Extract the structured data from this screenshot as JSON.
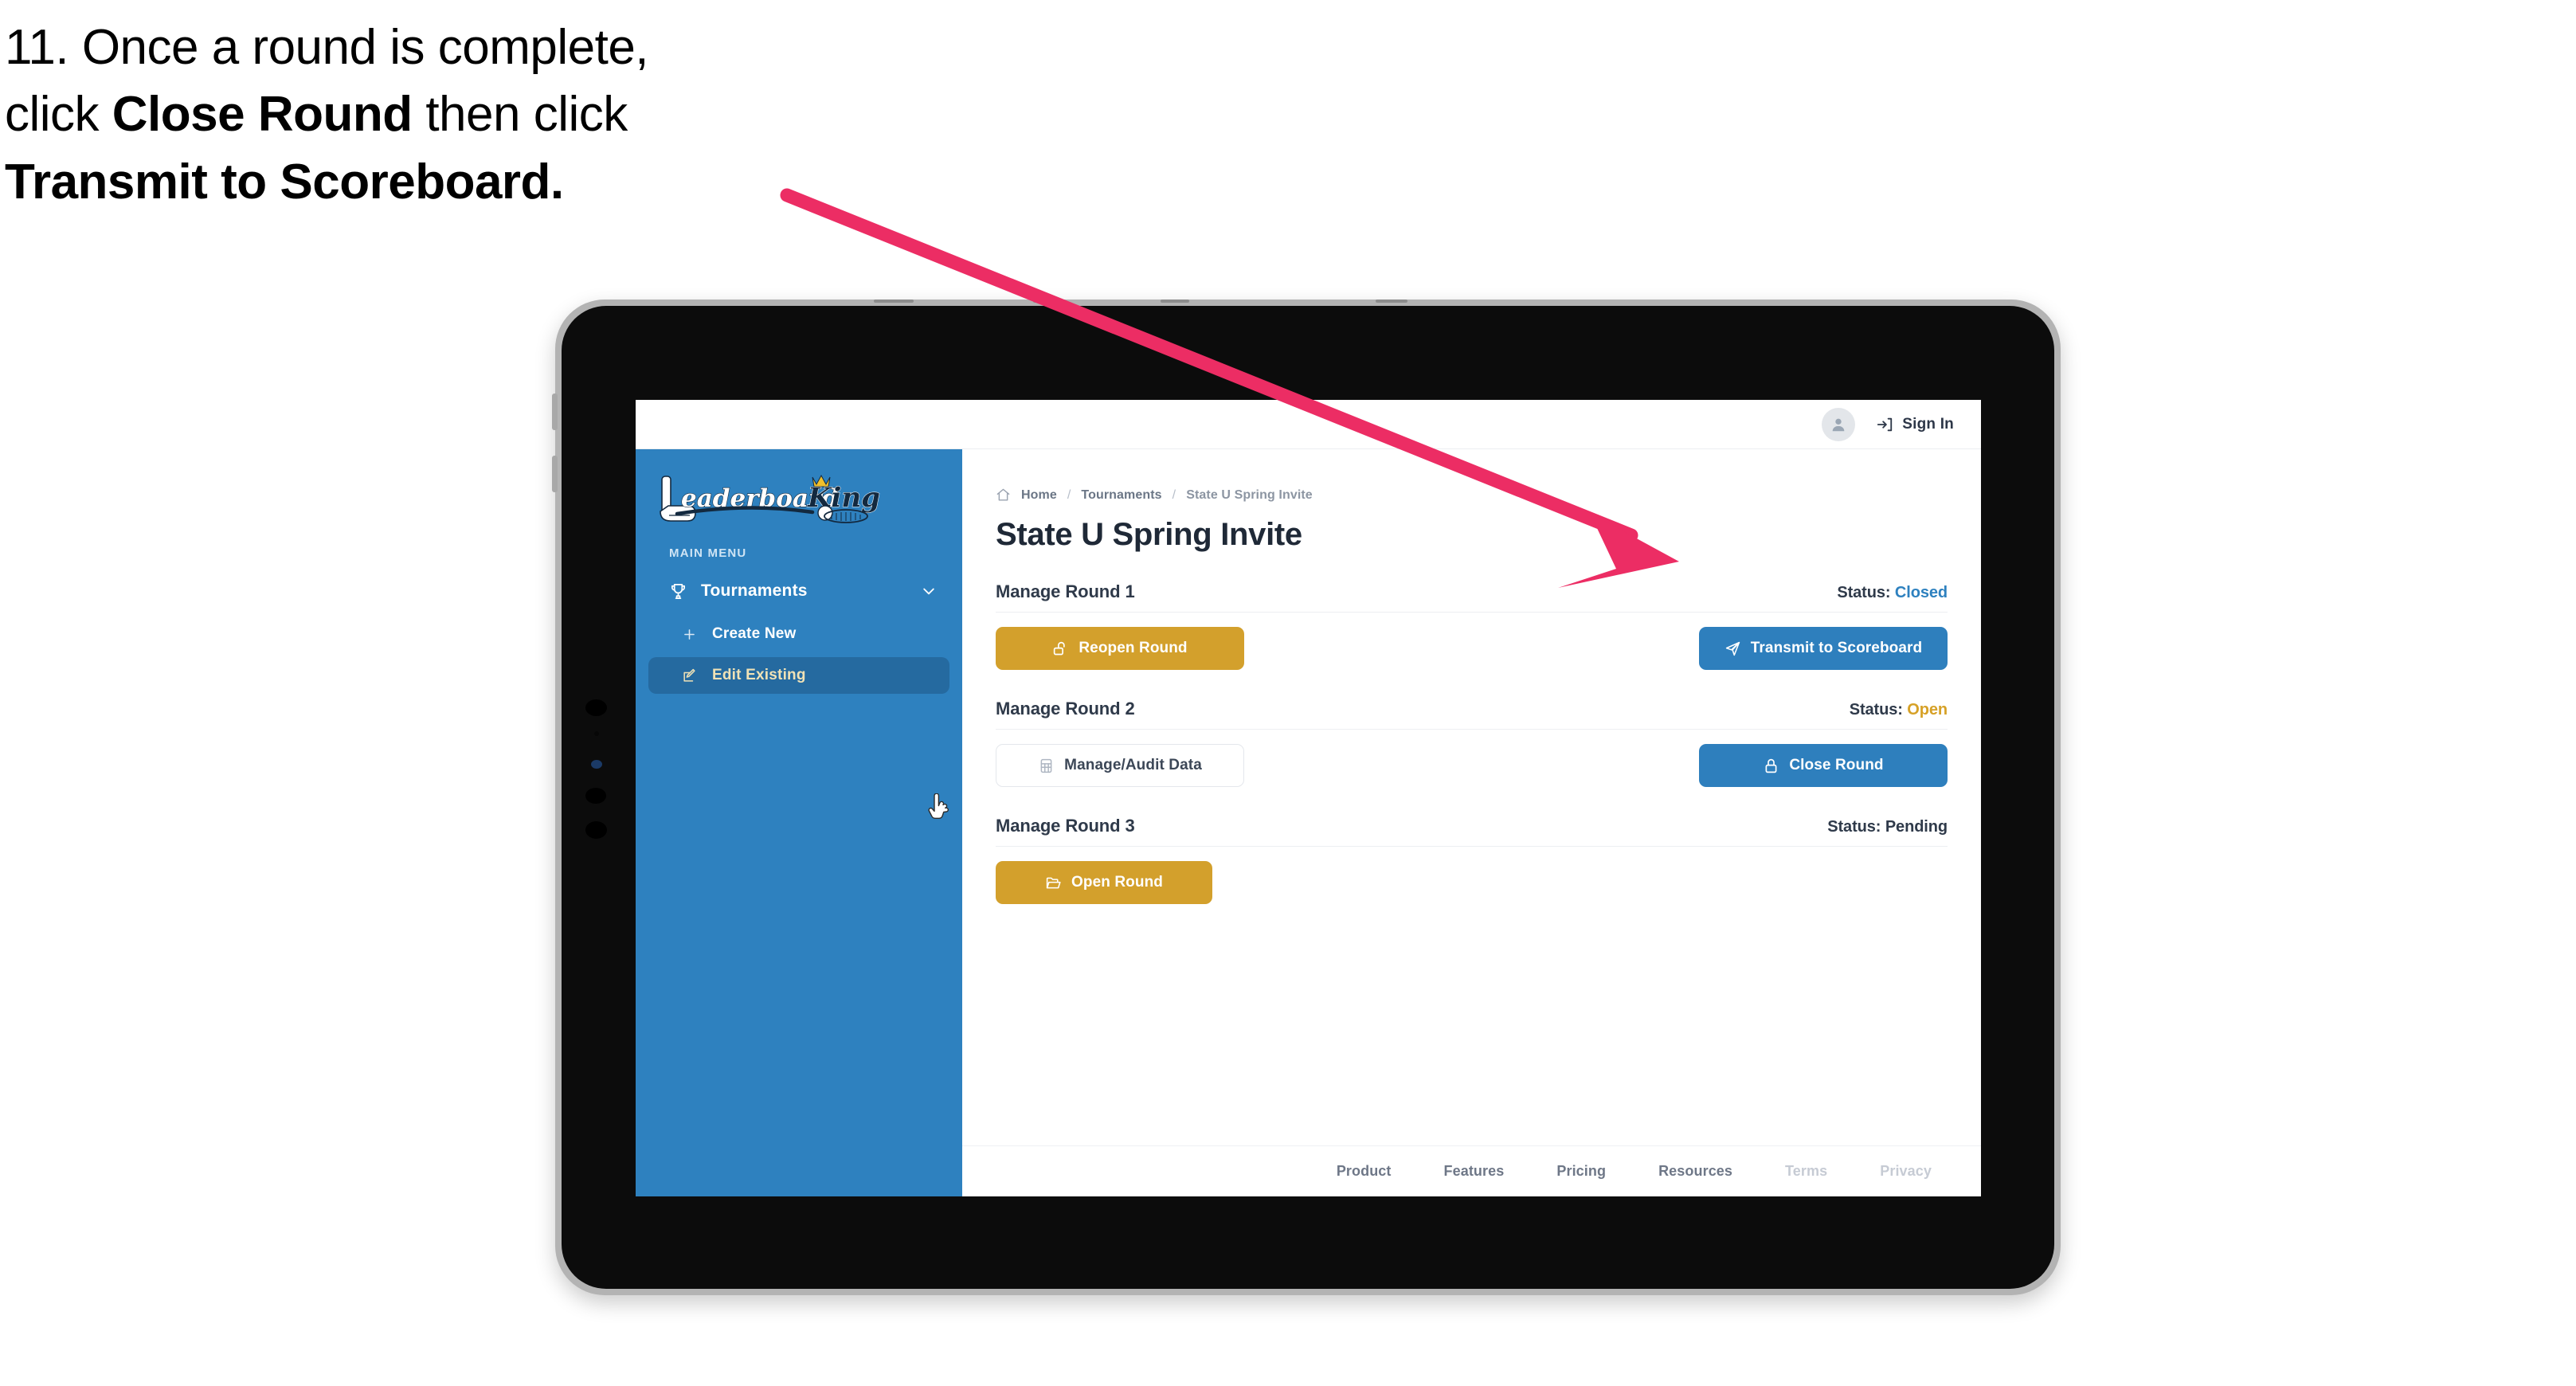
{
  "caption": {
    "line1": "11. Once a round is complete,",
    "line2_pre": "click ",
    "line2_bold": "Close Round",
    "line2_post": " then click",
    "line3_bold": "Transmit to Scoreboard.",
    "arrow_color": "#EC2D64"
  },
  "app": {
    "logo_primary": "Leaderboard",
    "logo_secondary": "King",
    "topbar": {
      "avatar_icon": "user-avatar-icon",
      "signin_icon": "sign-in-arrow-icon",
      "signin_label": "Sign In"
    },
    "sidebar": {
      "section_label": "MAIN MENU",
      "accent_bg": "#2E81BF",
      "active_bg": "#256AA0",
      "active_text": "#F0E2B6",
      "items": [
        {
          "label": "Tournaments",
          "icon": "trophy-icon",
          "chevron": "chevron-down-icon",
          "expanded": true
        }
      ],
      "sub_items": [
        {
          "label": "Create New",
          "icon": "plus-icon",
          "active": false
        },
        {
          "label": "Edit Existing",
          "icon": "edit-square-icon",
          "active": true
        }
      ],
      "cursor": "pointer-hand-cursor"
    },
    "breadcrumb": {
      "home_icon": "home-icon",
      "items": [
        "Home",
        "Tournaments",
        "State U Spring Invite"
      ],
      "separator": "/"
    },
    "page_title": "State U Spring Invite",
    "rounds": [
      {
        "title": "Manage Round 1",
        "status_label": "Status:",
        "status_value": "Closed",
        "status_color": "#2E81BF",
        "left_button": {
          "label": "Reopen Round",
          "icon": "unlock-icon",
          "style": "amber",
          "color": "#D3A02C"
        },
        "right_button": {
          "label": "Transmit to Scoreboard",
          "icon": "paper-plane-icon",
          "style": "blue",
          "color": "#2E7FBD"
        }
      },
      {
        "title": "Manage Round 2",
        "status_label": "Status:",
        "status_value": "Open",
        "status_color": "#D6A127",
        "left_button": {
          "label": "Manage/Audit Data",
          "icon": "table-grid-icon",
          "style": "ghost",
          "color": "#FFFFFF"
        },
        "right_button": {
          "label": "Close Round",
          "icon": "lock-icon",
          "style": "blue",
          "color": "#2E7FBD"
        }
      },
      {
        "title": "Manage Round 3",
        "status_label": "Status:",
        "status_value": "Pending",
        "status_color": "#2F3A4A",
        "left_button": {
          "label": "Open Round",
          "icon": "folder-open-icon",
          "style": "amber",
          "color": "#D3A02C"
        },
        "right_button": null
      }
    ],
    "footer": {
      "links": [
        {
          "label": "Product",
          "muted": false
        },
        {
          "label": "Features",
          "muted": false
        },
        {
          "label": "Pricing",
          "muted": false
        },
        {
          "label": "Resources",
          "muted": false
        },
        {
          "label": "Terms",
          "muted": true
        },
        {
          "label": "Privacy",
          "muted": true
        }
      ]
    }
  }
}
